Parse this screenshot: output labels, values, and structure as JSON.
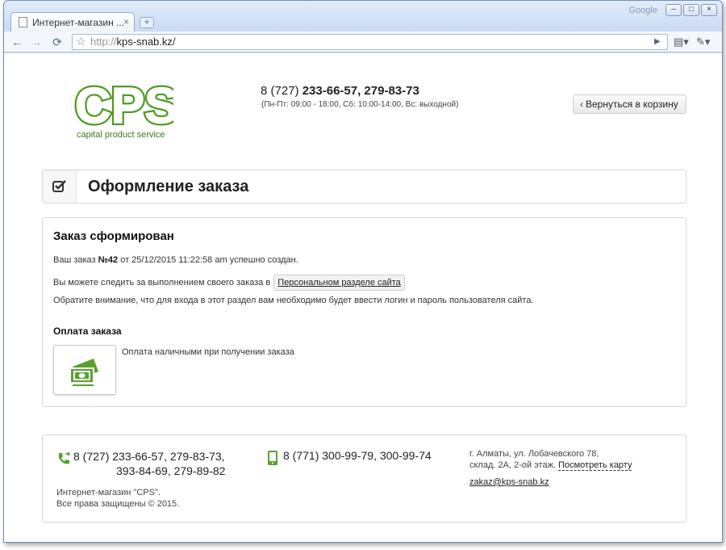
{
  "browser": {
    "tab_title": "Интернет-магазин ...",
    "tab_close": "×",
    "new_tab": "+",
    "brand": "Google",
    "window_buttons": [
      "–",
      "□",
      "×"
    ],
    "url_protocol": "http://",
    "url_host": "kps-snab.kz/",
    "back": "←",
    "forward": "→",
    "reload": "⟳",
    "star": "☆",
    "go": "▶",
    "page_menu": "▤▾",
    "tools_menu": "✎▾"
  },
  "header": {
    "logo_text": "CPS",
    "logo_tagline": "capital product service",
    "phone_prefix": "8 (727) ",
    "phone_numbers": "233-66-57, 279-83-73",
    "hours": "(Пн-Пт: 09:00 - 18:00,  Сб: 10:00-14:00, Вс: выходной)",
    "back_to_cart": "Вернуться в корзину",
    "back_chevron": "‹"
  },
  "title_panel": {
    "heading": "Оформление заказа"
  },
  "order": {
    "heading": "Заказ сформирован",
    "line_prefix": "Ваш заказ ",
    "order_number": "№42",
    "line_suffix": " от 25/12/2015 11:22:58 am успешно создан.",
    "track_text": "Вы можете следить за выполнением своего заказа в",
    "track_link": "Персональном разделе сайта",
    "note": "Обратите внимание, что для входа в этот раздел вам необходимо будет ввести логин и пароль пользователя сайта.",
    "payment_heading": "Оплата заказа",
    "payment_method": "Оплата наличными при получении заказа"
  },
  "footer": {
    "phone1_line1": "8 (727) 233-66-57, 279-83-73,",
    "phone1_line2": "393-84-69, 279-89-82",
    "phone2": "8 (771) 300-99-79, 300-99-74",
    "address_line1": "г. Алматы, ул. Лобачевского 78,",
    "address_line2": "склад. 2А, 2-ой этаж.",
    "map_link": "Посмотреть карту",
    "email": "zakaz@kps-snab.kz",
    "copyright_line1": "Интернет-магазин \"CPS\".",
    "copyright_line2": "Все права защищены © 2015."
  },
  "colors": {
    "brand_green": "#5aa02c",
    "dark_green": "#3c7a1c"
  }
}
